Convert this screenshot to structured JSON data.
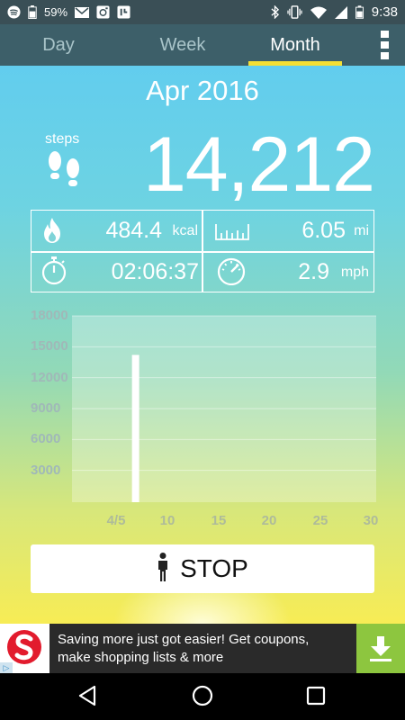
{
  "status_bar": {
    "battery_percent": "59%",
    "time": "9:38",
    "icons": [
      "spotify-icon",
      "email-icon",
      "instagram-icon",
      "app-icon",
      "bluetooth-icon",
      "vibrate-icon",
      "wifi-icon",
      "signal-icon",
      "battery-icon"
    ]
  },
  "tabs": [
    {
      "label": "Day",
      "active": false
    },
    {
      "label": "Week",
      "active": false
    },
    {
      "label": "Month",
      "active": true
    }
  ],
  "period": "Apr 2016",
  "steps": {
    "label": "steps",
    "value": "14,212"
  },
  "stats": {
    "calories": {
      "value": "484.4",
      "unit": "kcal"
    },
    "distance": {
      "value": "6.05",
      "unit": "mi"
    },
    "duration": {
      "value": "02:06:37"
    },
    "speed": {
      "value": "2.9",
      "unit": "mph"
    }
  },
  "chart_data": {
    "type": "bar",
    "x": [
      7
    ],
    "values": [
      14212
    ],
    "xlim": [
      1,
      30
    ],
    "ylim": [
      0,
      18000
    ],
    "y_ticks": [
      "18000",
      "15000",
      "12000",
      "9000",
      "6000",
      "3000"
    ],
    "x_ticks": [
      "4/5",
      "10",
      "15",
      "20",
      "25",
      "30"
    ],
    "grid": true,
    "bar_color": "#ffffff"
  },
  "stop_button": {
    "label": "STOP"
  },
  "ad": {
    "line1": "Saving more just got easier! Get coupons,",
    "line2": "make shopping lists & more",
    "badge": "▷",
    "logo_color": "#e21b2d",
    "download_color": "#8dc63f"
  },
  "colors": {
    "status_bar": "#3a4f56",
    "tab_bar": "#3d5f69",
    "tab_indicator": "#f4df33",
    "gradient_top": "#62cdee",
    "gradient_bottom": "#f7ec55"
  }
}
